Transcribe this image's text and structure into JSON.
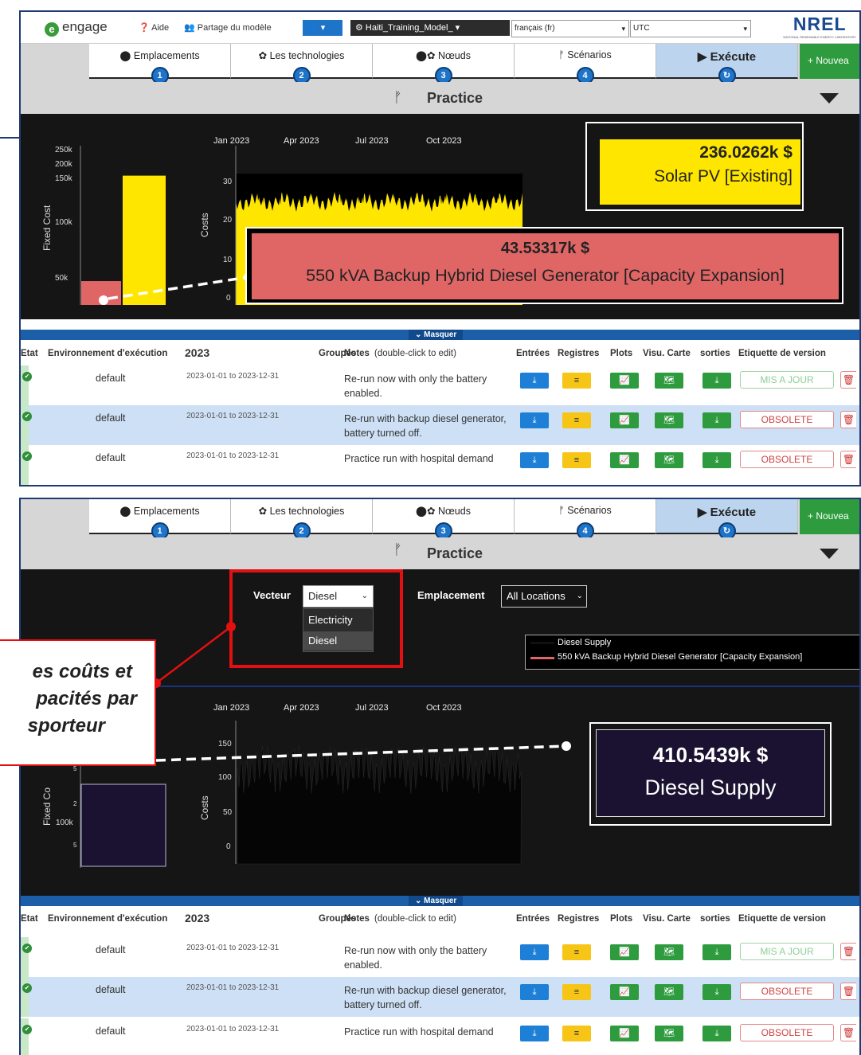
{
  "app": {
    "logo": "engage",
    "aide": "Aide",
    "share": "Partage du modèle",
    "model": "Haiti_Training_Model_",
    "language": "français (fr)",
    "timezone": "UTC",
    "brand": "NREL",
    "brand_sub": "NATIONAL RENEWABLE ENERGY LABORATORY"
  },
  "tabs": [
    {
      "label": "Emplacements",
      "num": "1"
    },
    {
      "label": "Les technologies",
      "num": "2"
    },
    {
      "label": "Nœuds",
      "num": "3"
    },
    {
      "label": "Scénarios",
      "num": "4"
    },
    {
      "label": "Exécute",
      "num": "↻"
    }
  ],
  "new_button": "+ Nouvea",
  "scenario_title": "Practice",
  "chart1": {
    "fixed_ylabel": "Fixed Cost",
    "fixed_ticks": [
      "250k",
      "200k",
      "150k",
      "100k",
      "50k"
    ],
    "costs_ylabel": "Costs",
    "costs_ticks": [
      "30",
      "20",
      "10",
      "0"
    ],
    "months": [
      "Jan 2023",
      "Apr 2023",
      "Jul 2023",
      "Oct 2023"
    ],
    "chart_data": {
      "type": "bar",
      "categories": [
        "550 kVA Backup Hybrid Diesel Generator  [Capacity Expansion]",
        "Solar PV [Existing]"
      ],
      "values": [
        43.53317,
        236.0262
      ],
      "ylabel": "Fixed Cost",
      "ylim": [
        0,
        250
      ],
      "colors": [
        "#e06666",
        "#ffe600"
      ]
    },
    "tooltip_solar": {
      "value": "236.0262k $",
      "label": "Solar PV [Existing]"
    },
    "tooltip_diesel": {
      "value": "43.53317k $",
      "label": "550 kVA Backup Hybrid Diesel Generator  [Capacity Expansion]"
    }
  },
  "masquer": "Masquer",
  "filters": {
    "vecteur_label": "Vecteur",
    "vecteur_value": "Diesel",
    "vecteur_options": [
      "Electricity",
      "Diesel"
    ],
    "emplacement_label": "Emplacement",
    "emplacement_value": "All Locations"
  },
  "legend": [
    "Diesel Supply",
    "550 kVA Backup Hybrid Diesel Generator  [Capacity Expansion]"
  ],
  "chart2": {
    "fixed_ylabel": "Fixed Co",
    "fixed_ticks": [
      "5",
      "2",
      "100k",
      "5"
    ],
    "costs_ylabel": "Costs",
    "costs_ticks": [
      "150",
      "100",
      "50",
      "0"
    ],
    "months": [
      "Jan 2023",
      "Apr 2023",
      "Jul 2023",
      "Oct 2023"
    ],
    "tooltip": {
      "value": "410.5439k $",
      "label": "Diesel Supply"
    }
  },
  "callout": {
    "lines": [
      "es coûts et",
      "pacités par",
      "sporteur"
    ]
  },
  "table": {
    "headers": {
      "etat": "Etat",
      "env": "Environnement d'exécution",
      "year": "2023",
      "groupes": "Groupés",
      "notes": "Notes",
      "notes_hint": "(double-click to edit)",
      "entrees": "Entrées",
      "registres": "Registres",
      "plots": "Plots",
      "visu": "Visu. Carte",
      "sorties": "sorties",
      "etiquette": "Etiquette de version"
    },
    "rows": [
      {
        "env": "default",
        "dates": "2023-01-01 to 2023-12-31",
        "note": "Re-run now with only the battery enabled.",
        "tag": "MIS A JOUR"
      },
      {
        "env": "default",
        "dates": "2023-01-01 to 2023-12-31",
        "note": "Re-run with backup diesel generator, battery turned off.",
        "tag": "OBSOLETE"
      },
      {
        "env": "default",
        "dates": "2023-01-01 to 2023-12-31",
        "note": "Practice run with hospital demand",
        "tag": "OBSOLETE"
      }
    ]
  }
}
